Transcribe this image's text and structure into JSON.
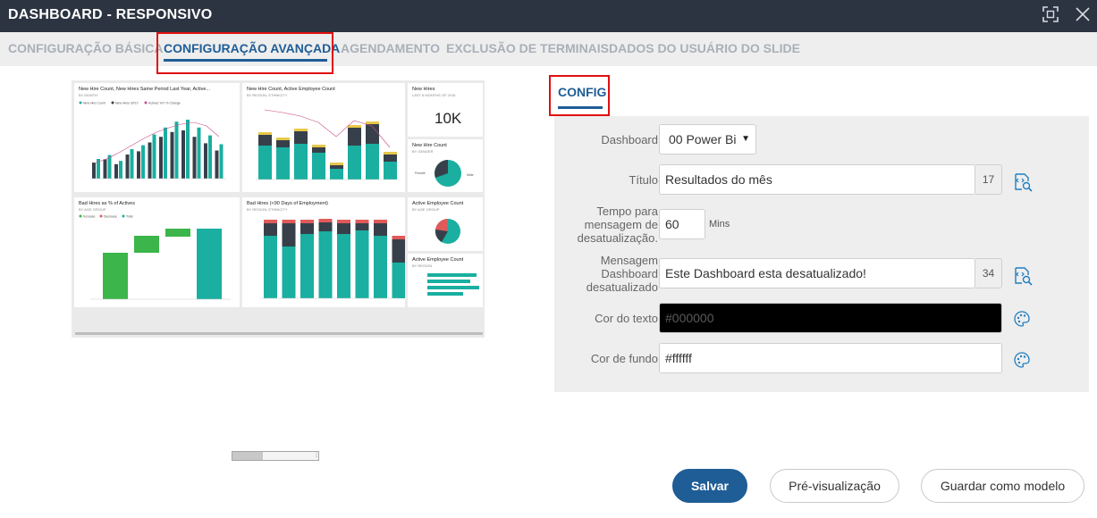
{
  "window": {
    "title": "DASHBOARD - RESPONSIVO"
  },
  "tabs": [
    {
      "label": "CONFIGURAÇÃO BÁSICA",
      "active": false
    },
    {
      "label": "CONFIGURAÇÃO AVANÇADA",
      "active": true
    },
    {
      "label": "AGENDAMENTO",
      "active": false
    },
    {
      "label": "EXCLUSÃO DE TERMINAIS",
      "active": false
    },
    {
      "label": "DADOS DO USUÁRIO DO SLIDE",
      "active": false
    }
  ],
  "preview": {
    "panels": [
      {
        "title": "New Hire Count, New Hires Same Period Last Year, Active...",
        "subtitle": "BY MONTH",
        "legend": [
          "New Hire Count",
          "New Hires SPLY",
          "Actives YoY % Change"
        ]
      },
      {
        "title": "New Hire Count, Active Employee Count",
        "subtitle": "BY REGION, ETHNICITY"
      },
      {
        "title": "New Hires",
        "subtitle": "LAST 6 MONTHS OF 2016",
        "kpi": "10K"
      },
      {
        "title": "New Hire Count",
        "subtitle": "BY GENDER",
        "labels": [
          "Female",
          "Male"
        ]
      },
      {
        "title": "Bad Hires as % of Actives",
        "subtitle": "BY AGE GROUP",
        "legend": [
          "Increase",
          "Decrease",
          "Total"
        ]
      },
      {
        "title": "Bad Hires (<90 Days of Employment)",
        "subtitle": "BY REGION, ETHNICITY"
      },
      {
        "title": "Active Employee Count",
        "subtitle": "BY AGE GROUP"
      },
      {
        "title": "Active Employee Count",
        "subtitle": "BY REGION"
      }
    ]
  },
  "config": {
    "tab_label": "CONFIG",
    "dashboard": {
      "label": "Dashboard",
      "value": "00 Power Bi"
    },
    "titulo": {
      "label": "Título",
      "value": "Resultados do mês",
      "count": "17"
    },
    "tempo": {
      "label": "Tempo para mensagem de desatualização.",
      "value": "60",
      "unit": "Mins"
    },
    "mensagem": {
      "label": "Mensagem Dashboard desatualizado",
      "value": "Este Dashboard esta desatualizado!",
      "count": "34"
    },
    "cor_texto": {
      "label": "Cor do texto",
      "value": "#000000",
      "swatch": "#000000"
    },
    "cor_fundo": {
      "label": "Cor de fundo",
      "value": "#ffffff",
      "swatch": "#ffffff"
    }
  },
  "buttons": {
    "save": "Salvar",
    "preview": "Pré-visualização",
    "template": "Guardar como modelo"
  },
  "colors": {
    "titlebar": "#2c3442",
    "accent": "#1f5d96",
    "highlight": "#e01010",
    "teal": "#1aafa0",
    "dark": "#37404a",
    "green": "#3cb54a",
    "red": "#e05a5a"
  },
  "icons": [
    "fullscreen-icon",
    "close-icon",
    "dropdown-arrow-icon",
    "field-search-icon",
    "palette-icon"
  ]
}
